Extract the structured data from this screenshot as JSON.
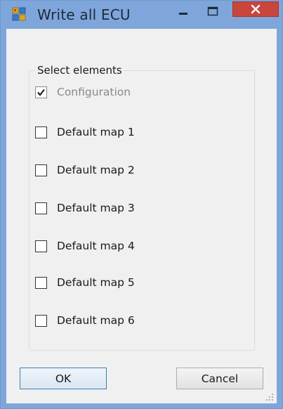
{
  "window": {
    "title": "Write all ECU",
    "minimize_label": "Minimize",
    "maximize_label": "Maximize",
    "close_label": "Close"
  },
  "group": {
    "legend": "Select elements",
    "items": [
      {
        "label": "Configuration",
        "checked": true,
        "enabled": false
      },
      {
        "label": "Default map 1",
        "checked": false,
        "enabled": true
      },
      {
        "label": "Default map 2",
        "checked": false,
        "enabled": true
      },
      {
        "label": "Default map 3",
        "checked": false,
        "enabled": true
      },
      {
        "label": "Default map 4",
        "checked": false,
        "enabled": true
      },
      {
        "label": "Default map 5",
        "checked": false,
        "enabled": true
      },
      {
        "label": "Default map 6",
        "checked": false,
        "enabled": true
      }
    ]
  },
  "buttons": {
    "ok_label": "OK",
    "cancel_label": "Cancel"
  },
  "colors": {
    "titlebar": "#7ea6db",
    "close_button": "#c9463d",
    "client_background": "#f0f0f0",
    "default_button_border": "#3c7fb1"
  },
  "icons": {
    "app": "app-window-icon",
    "minimize": "minimize-icon",
    "maximize": "maximize-icon",
    "close": "close-icon",
    "check": "checkmark-icon",
    "grip": "resize-grip-icon"
  }
}
